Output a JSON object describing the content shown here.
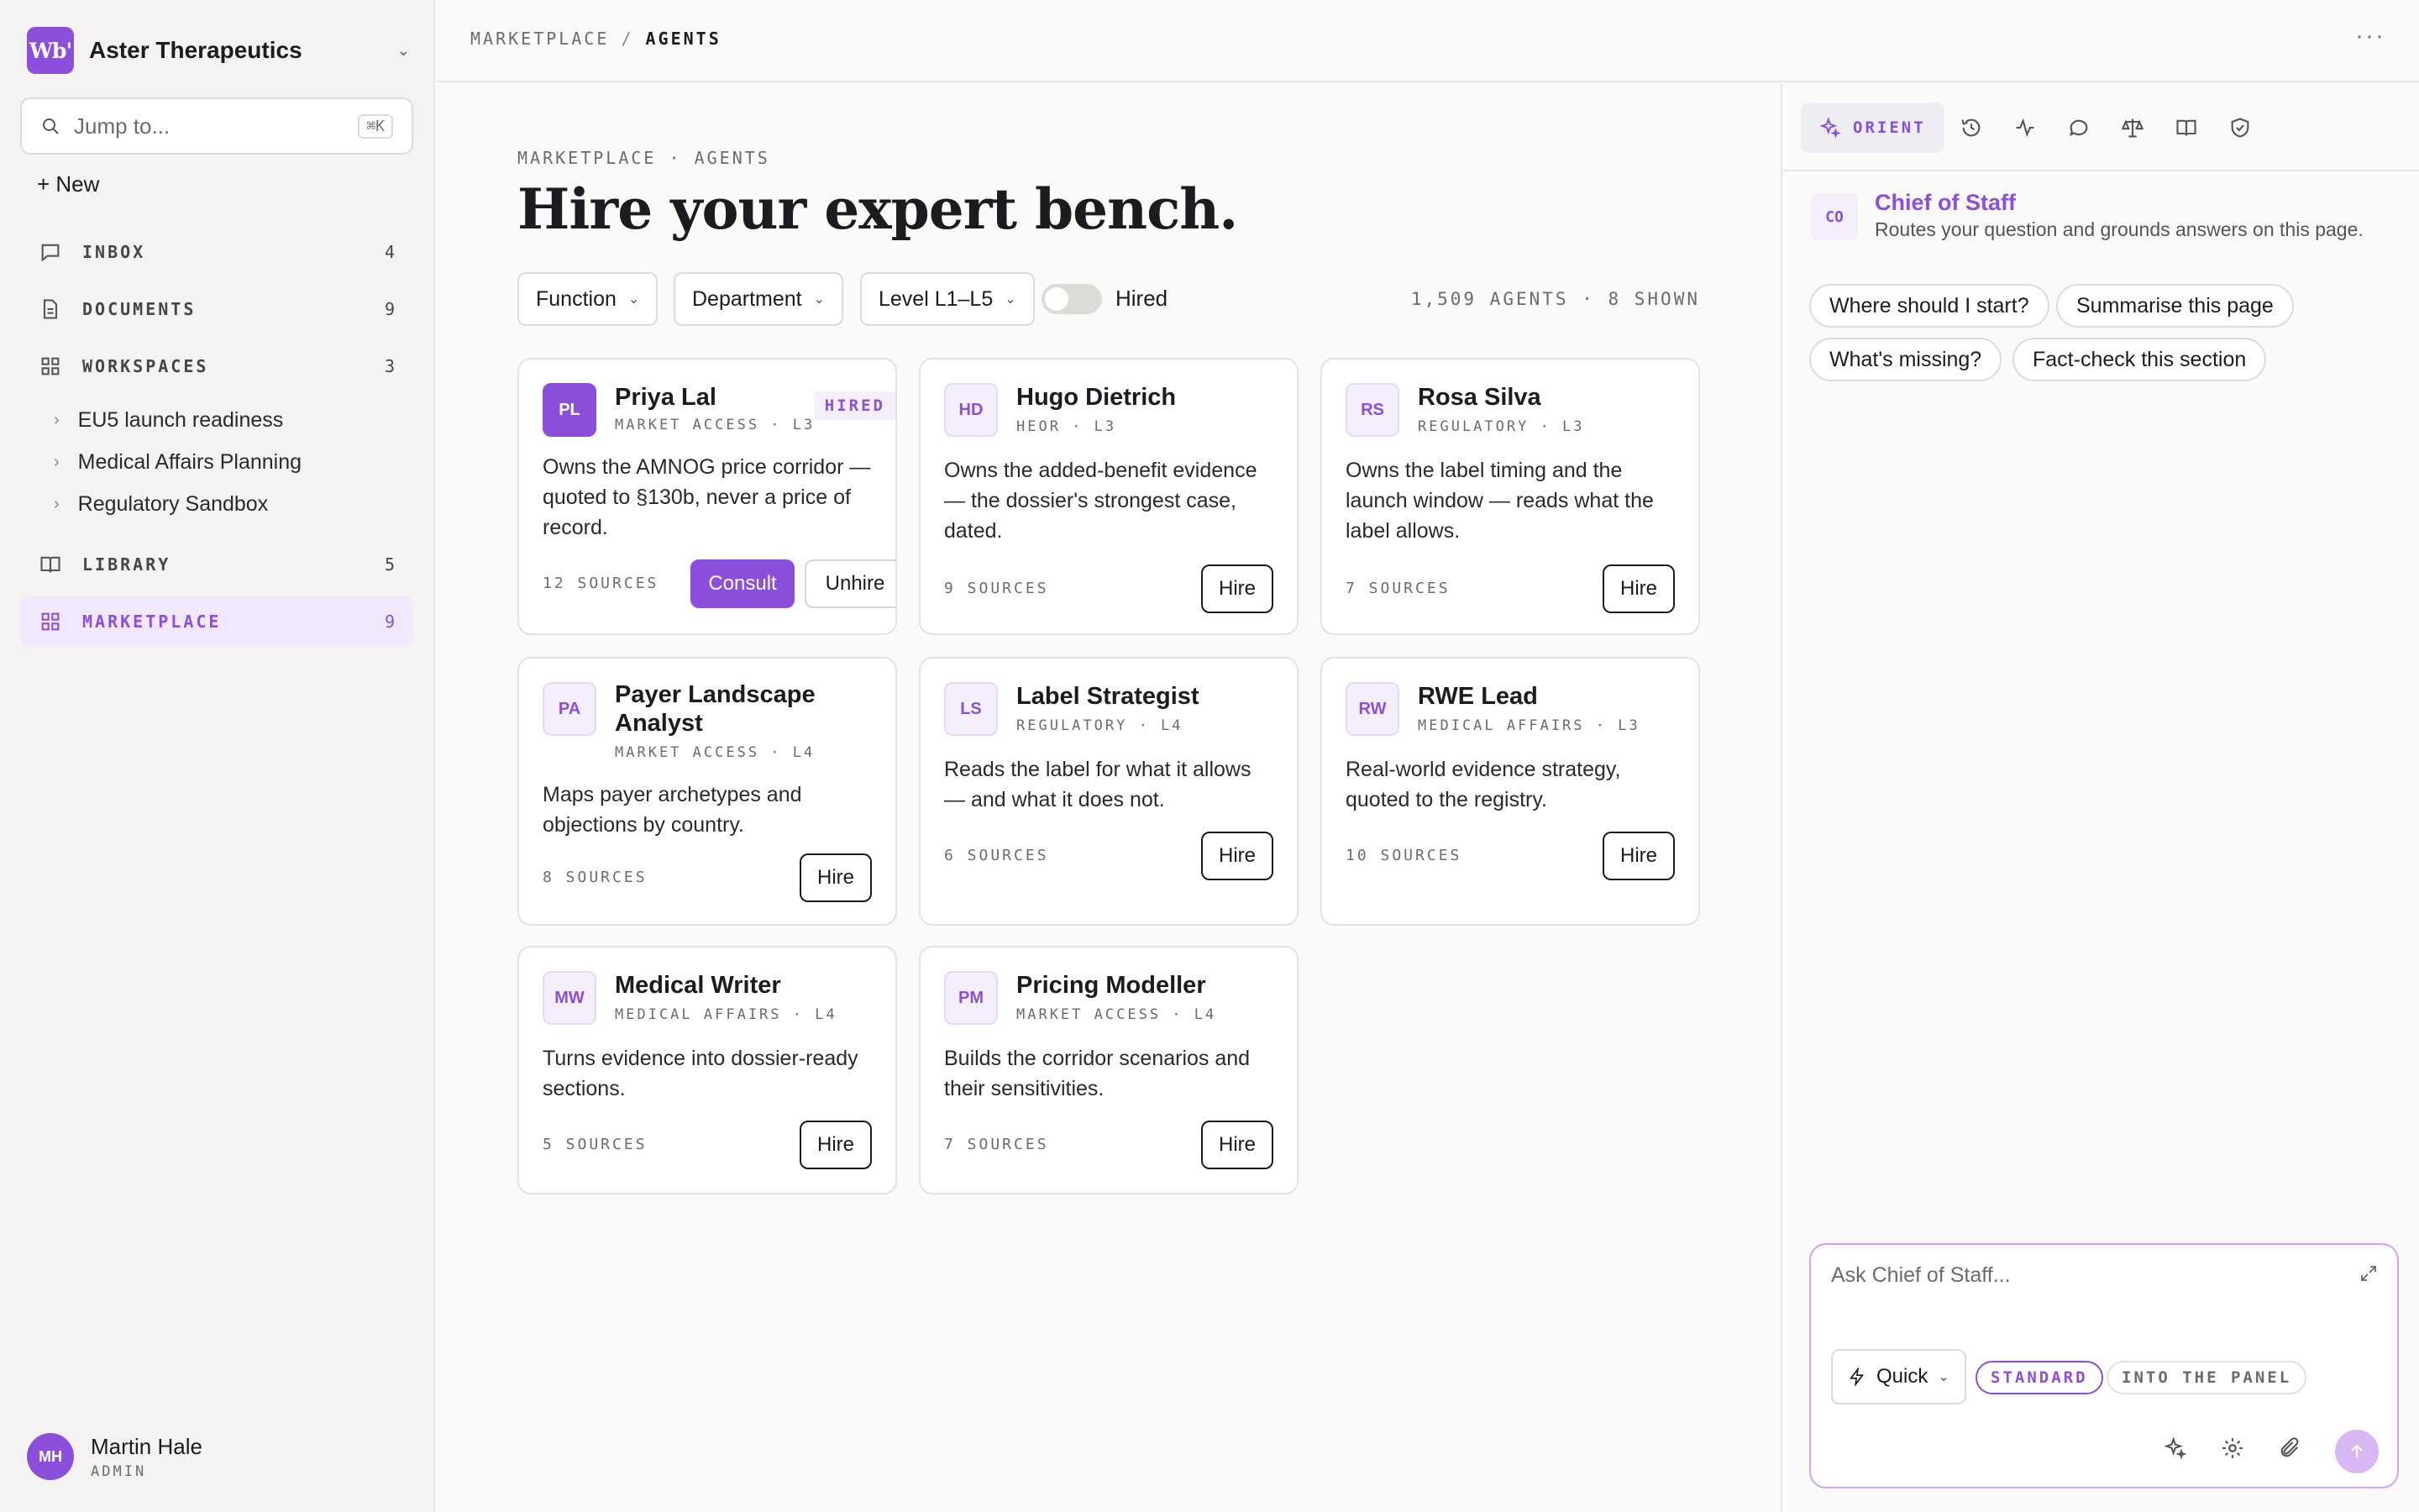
{
  "workspace": {
    "logo": "Wb'",
    "name": "Aster Therapeutics"
  },
  "search": {
    "placeholder": "Jump to...",
    "shortcut": "⌘K"
  },
  "sidebar": {
    "new_label": "+ New",
    "nav": [
      {
        "label": "INBOX",
        "count": "4",
        "icon": "inbox-icon"
      },
      {
        "label": "DOCUMENTS",
        "count": "9",
        "icon": "document-icon"
      },
      {
        "label": "WORKSPACES",
        "count": "3",
        "icon": "grid-icon"
      },
      {
        "label": "LIBRARY",
        "count": "5",
        "icon": "book-icon"
      },
      {
        "label": "MARKETPLACE",
        "count": "9",
        "icon": "grid-icon",
        "active": true
      }
    ],
    "workspaces": [
      "EU5 launch readiness",
      "Medical Affairs Planning",
      "Regulatory Sandbox"
    ]
  },
  "user": {
    "initials": "MH",
    "name": "Martin Hale",
    "role": "ADMIN"
  },
  "breadcrumb": {
    "root": "MARKETPLACE",
    "current": "AGENTS"
  },
  "page": {
    "eyebrow": "MARKETPLACE · AGENTS",
    "title": "Hire your expert bench.",
    "filters": [
      "Function",
      "Department",
      "Level L1–L5"
    ],
    "toggle_label": "Hired",
    "count": "1,509 AGENTS · 8 SHOWN"
  },
  "agents": [
    {
      "initials": "PL",
      "name": "Priya Lal",
      "meta": "MARKET ACCESS · L3",
      "badge": "HIRED",
      "desc": "Owns the AMNOG price corridor — quoted to §130b, never a price of record.",
      "sources": "12 SOURCES",
      "primary": "Consult",
      "secondary": "Unhire"
    },
    {
      "initials": "HD",
      "name": "Hugo Dietrich",
      "meta": "HEOR · L3",
      "desc": "Owns the added-benefit evidence — the dossier's strongest case, dated.",
      "sources": "9 SOURCES",
      "action": "Hire"
    },
    {
      "initials": "RS",
      "name": "Rosa Silva",
      "meta": "REGULATORY · L3",
      "desc": "Owns the label timing and the launch window — reads what the label allows.",
      "sources": "7 SOURCES",
      "action": "Hire"
    },
    {
      "initials": "PA",
      "name": "Payer Landscape Analyst",
      "meta": "MARKET ACCESS · L4",
      "desc": "Maps payer archetypes and objections by country.",
      "sources": "8 SOURCES",
      "action": "Hire"
    },
    {
      "initials": "LS",
      "name": "Label Strategist",
      "meta": "REGULATORY · L4",
      "desc": "Reads the label for what it allows — and what it does not.",
      "sources": "6 SOURCES",
      "action": "Hire"
    },
    {
      "initials": "RW",
      "name": "RWE Lead",
      "meta": "MEDICAL AFFAIRS · L3",
      "desc": "Real-world evidence strategy, quoted to the registry.",
      "sources": "10 SOURCES",
      "action": "Hire"
    },
    {
      "initials": "MW",
      "name": "Medical Writer",
      "meta": "MEDICAL AFFAIRS · L4",
      "desc": "Turns evidence into dossier-ready sections.",
      "sources": "5 SOURCES",
      "action": "Hire"
    },
    {
      "initials": "PM",
      "name": "Pricing Modeller",
      "meta": "MARKET ACCESS · L4",
      "desc": "Builds the corridor scenarios and their sensitivities.",
      "sources": "7 SOURCES",
      "action": "Hire"
    }
  ],
  "panel": {
    "tab_active": "ORIENT",
    "tab_icons": [
      "history-icon",
      "activity-icon",
      "chat-icon",
      "scale-icon",
      "book-icon",
      "shield-check-icon"
    ],
    "assistant": {
      "initials": "CO",
      "name": "Chief of Staff",
      "subtitle": "Routes your question and grounds answers on this page."
    },
    "suggestions": [
      "Where should I start?",
      "Summarise this page",
      "What's missing?",
      "Fact-check this section"
    ],
    "composer": {
      "placeholder": "Ask Chief of Staff...",
      "mode": "Quick",
      "pill_on": "STANDARD",
      "pill_off": "INTO THE PANEL"
    }
  },
  "colors": {
    "accent": "#8b4fdc",
    "accent_soft": "#f5eefc"
  }
}
